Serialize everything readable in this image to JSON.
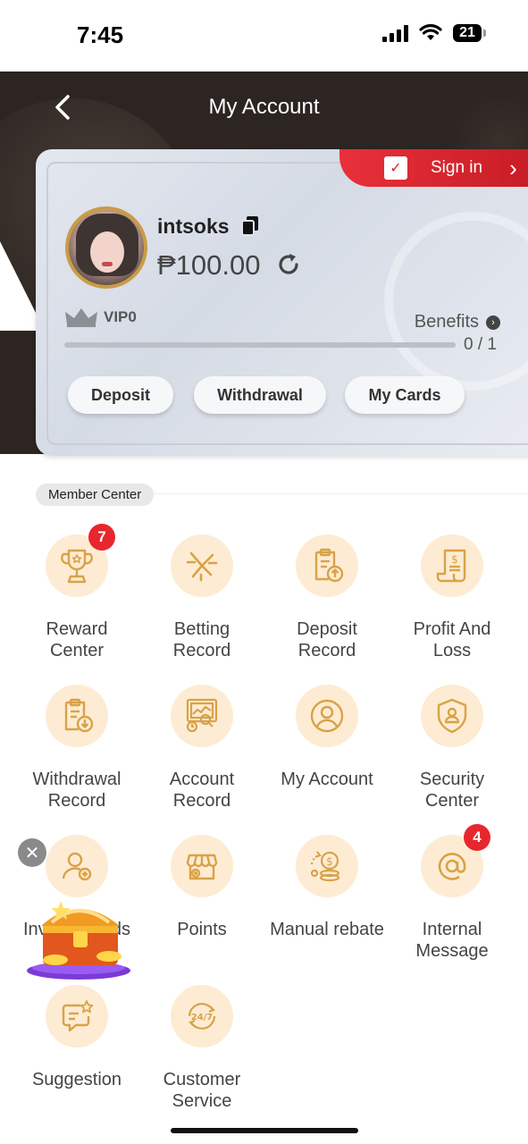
{
  "status": {
    "time": "7:45",
    "battery": "21"
  },
  "header": {
    "title": "My Account"
  },
  "card": {
    "signin_label": "Sign in",
    "username": "intsoks",
    "balance": "₱100.00",
    "vip_label": "VIP0",
    "benefits_label": "Benefits",
    "progress_text": "0 / 1",
    "progress_fraction": 0,
    "buttons": {
      "deposit": "Deposit",
      "withdrawal": "Withdrawal",
      "cards": "My Cards"
    }
  },
  "member_center": {
    "tag": "Member Center",
    "items": [
      {
        "label": "Reward Center",
        "icon": "trophy-icon",
        "badge": "7"
      },
      {
        "label": "Betting Record",
        "icon": "betting-icon"
      },
      {
        "label": "Deposit Record",
        "icon": "deposit-record-icon"
      },
      {
        "label": "Profit And Loss",
        "icon": "profit-loss-icon"
      },
      {
        "label": "Withdrawal Record",
        "icon": "withdrawal-record-icon"
      },
      {
        "label": "Account Record",
        "icon": "account-record-icon"
      },
      {
        "label": "My Account",
        "icon": "user-icon"
      },
      {
        "label": "Security Center",
        "icon": "shield-icon"
      },
      {
        "label": "Invite Friends",
        "icon": "invite-icon"
      },
      {
        "label": "Points",
        "icon": "points-shop-icon"
      },
      {
        "label": "Manual rebate",
        "icon": "rebate-coins-icon"
      },
      {
        "label": "Internal Message",
        "icon": "at-sign-icon",
        "badge": "4"
      },
      {
        "label": "Suggestion",
        "icon": "suggestion-icon"
      },
      {
        "label": "Customer Service",
        "icon": "customer-service-24-7-icon"
      }
    ]
  },
  "colors": {
    "accent_red": "#e8262d",
    "tile_bg": "#fdecd3",
    "icon_gold": "#d9a248",
    "header_dark": "#2c2522"
  }
}
